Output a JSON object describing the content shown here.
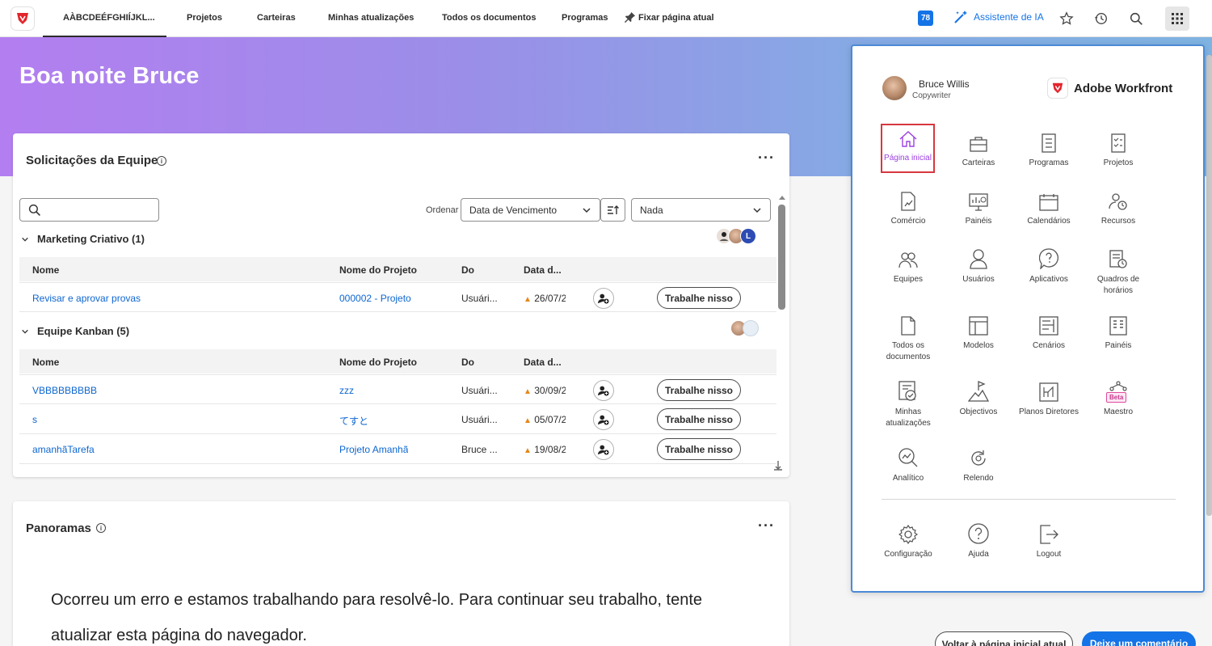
{
  "nav": {
    "tabs": [
      "AÀBCDEÉFGHIÍJKL...",
      "Projetos",
      "Carteiras",
      "Minhas atualizações",
      "Todos os documentos",
      "Programas"
    ],
    "pin_label": "Fixar página atual",
    "badge_count": "78",
    "ai_label": "Assistente de IA"
  },
  "hero": {
    "greeting": "Boa noite Bruce"
  },
  "team_requests": {
    "title": "Solicitações da Equipe",
    "sort_label": "Ordenar",
    "sort_value": "Data de Vencimento",
    "filter_value": "Nada",
    "columns": [
      "Nome",
      "Nome do Projeto",
      "Do",
      "Data d..."
    ],
    "work_label": "Trabalhe nisso",
    "groups": [
      {
        "name": "Marketing Criativo (1)",
        "rows": [
          {
            "name": "Revisar e aprovar provas",
            "project": "000002 - Projeto",
            "from": "Usuári...",
            "date": "26/07/2"
          }
        ]
      },
      {
        "name": "Equipe Kanban (5)",
        "rows": [
          {
            "name": "VBBBBBBBBB",
            "project": "zzz",
            "from": "Usuári...",
            "date": "30/09/2"
          },
          {
            "name": "s",
            "project": "てすと",
            "from": "Usuári...",
            "date": "05/07/2"
          },
          {
            "name": "amanhãTarefa",
            "project": "Projeto Amanhã",
            "from": "Bruce ...",
            "date": "19/08/2"
          }
        ]
      }
    ]
  },
  "panoramas": {
    "title": "Panoramas",
    "error": "Ocorreu um erro e estamos trabalhando para resolvê-lo. Para continuar seu trabalho, tente atualizar esta página do navegador."
  },
  "launcher": {
    "user_name": "Bruce Willis",
    "user_role": "Copywriter",
    "brand": "Adobe Workfront",
    "tiles": [
      {
        "label": "Página inicial",
        "icon": "home-icon"
      },
      {
        "label": "Carteiras",
        "icon": "briefcase-icon"
      },
      {
        "label": "Programas",
        "icon": "program-icon"
      },
      {
        "label": "Projetos",
        "icon": "project-icon"
      },
      {
        "label": "Comércio",
        "icon": "commerce-icon"
      },
      {
        "label": "Painéis",
        "icon": "dashboard-icon"
      },
      {
        "label": "Calendários",
        "icon": "calendar-icon"
      },
      {
        "label": "Recursos",
        "icon": "resources-icon"
      },
      {
        "label": "Equipes",
        "icon": "teams-icon"
      },
      {
        "label": "Usuários",
        "icon": "user-icon"
      },
      {
        "label": "Aplicativos",
        "icon": "help-bubble-icon"
      },
      {
        "label": "Quadros de horários",
        "icon": "timesheet-icon"
      },
      {
        "label": "Todos os documentos",
        "icon": "document-icon"
      },
      {
        "label": "Modelos",
        "icon": "template-icon"
      },
      {
        "label": "Cenários",
        "icon": "scenario-icon"
      },
      {
        "label": "Painéis",
        "icon": "board-icon"
      },
      {
        "label": "Minhas atualizações",
        "icon": "updates-icon"
      },
      {
        "label": "Objectivos",
        "icon": "goals-icon"
      },
      {
        "label": "Planos Diretores",
        "icon": "plans-icon"
      },
      {
        "label": "Maestro",
        "icon": "maestro-icon",
        "badge": "Beta"
      },
      {
        "label": "Analítico",
        "icon": "analytics-icon"
      },
      {
        "label": "Relendo",
        "icon": "reload-icon"
      }
    ],
    "bottom": [
      {
        "label": "Configuração",
        "icon": "gear-icon"
      },
      {
        "label": "Ajuda",
        "icon": "help-icon"
      },
      {
        "label": "Logout",
        "icon": "logout-icon"
      }
    ]
  },
  "footer": {
    "back_label": "Voltar à página inicial atual",
    "comment_label": "Deixe um comentário"
  }
}
